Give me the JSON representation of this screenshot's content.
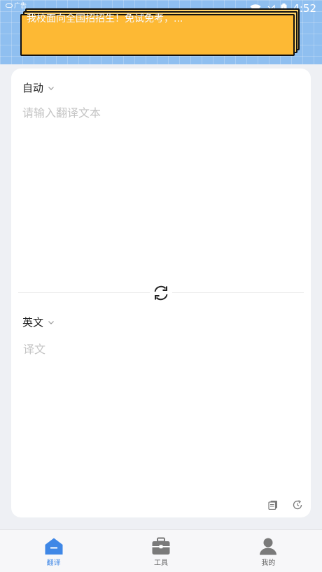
{
  "status_bar": {
    "ad_label": "广告",
    "time": "4:52"
  },
  "ad_banner": {
    "text": "我校面向全国招招生！免试免考，..."
  },
  "translator": {
    "source_lang": "自动",
    "target_lang": "英文",
    "input_placeholder": "请输入翻译文本",
    "result_placeholder": "译文"
  },
  "nav": {
    "items": [
      {
        "label": "翻译",
        "icon": "home-icon",
        "active": true
      },
      {
        "label": "工具",
        "icon": "toolbox-icon",
        "active": false
      },
      {
        "label": "我的",
        "icon": "user-icon",
        "active": false
      }
    ]
  },
  "colors": {
    "accent": "#3f87e6",
    "banner_bg": "#8fbff0",
    "ad_card": "#fdb934",
    "page_bg": "#eef0f4"
  }
}
